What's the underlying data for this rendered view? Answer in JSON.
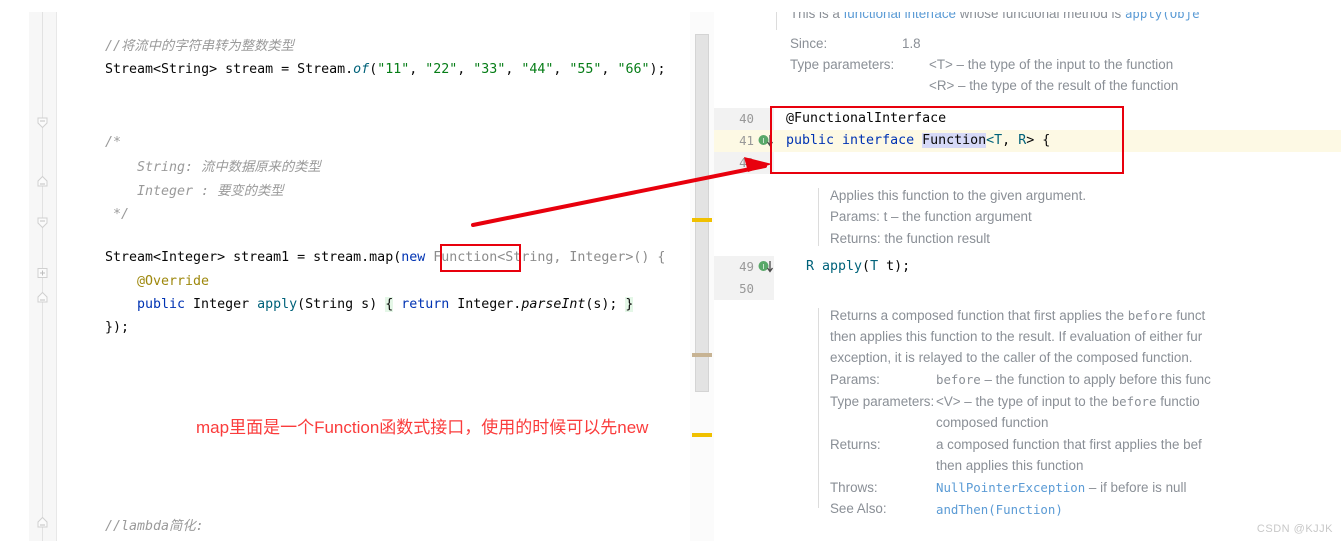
{
  "editor": {
    "lines": [
      {
        "id": "l1",
        "text": "//将流中的字符串转为整数类型"
      },
      {
        "id": "l2",
        "text": "Stream<String> stream = Stream.of(\"11\", \"22\", \"33\", \"44\", \"55\", \"66\");"
      },
      {
        "id": "l3",
        "text": "/*"
      },
      {
        "id": "l4",
        "text": "String: 流中数据原来的类型"
      },
      {
        "id": "l5",
        "text": "Integer : 要变的类型"
      },
      {
        "id": "l6",
        "text": "*/"
      },
      {
        "id": "l7",
        "text": "Stream<Integer> stream1 = stream.map(new Function<String, Integer>() {"
      },
      {
        "id": "l8",
        "text": "@Override"
      },
      {
        "id": "l9",
        "text": "public Integer apply(String s) { return Integer.parseInt(s); }"
      },
      {
        "id": "l10",
        "text": "});"
      },
      {
        "id": "l11",
        "text": "//lambda简化:"
      }
    ],
    "tokens": {
      "comment1": "//将流中的字符串转为整数类型",
      "stream_decl_a": "Stream<String> stream = Stream.",
      "stream_decl_of": "of",
      "stream_decl_b": "(",
      "s11": "\"11\"",
      "s22": "\"22\"",
      "s33": "\"33\"",
      "s44": "\"44\"",
      "s55": "\"55\"",
      "s66": "\"66\"",
      "comma": ", ",
      "stream_decl_end": ");",
      "blk_open": "/*",
      "blk_l1_key": "String:",
      "blk_l1_val": " 流中数据原来的类型",
      "blk_l2_key": "Integer :",
      "blk_l2_val": " 要变的类型",
      "blk_close": "*/",
      "map_a": "Stream<Integer> stream1 = stream.map(",
      "map_new": "new",
      "map_fn": "Function",
      "map_b": "<String, Integer>() {",
      "override": "@Override",
      "apply_kw": "public",
      "apply_a": " Integer ",
      "apply_name": "apply",
      "apply_b": "(String s) ",
      "apply_brace_open": "{",
      "apply_ret": " return ",
      "apply_int": "Integer.",
      "apply_parse": "parseInt",
      "apply_c": "(s); ",
      "apply_brace_close": "}",
      "close": "});",
      "lambda_cmt": "//lambda简化:"
    }
  },
  "doc": {
    "intro_a": "This is a ",
    "intro_link": "functional interface",
    "intro_b": " whose functional method is ",
    "intro_code": "apply(Obje",
    "since_label": "Since:",
    "since_value": "1.8",
    "typeparams_label": "Type parameters:",
    "typeparam_t": "<T> – the type of the input to the function",
    "typeparam_r": "<R> – the type of the result of the function",
    "apply_desc": "Applies this function to the given argument.",
    "apply_params": "Params:  t – the function argument",
    "apply_returns": "Returns: the function result",
    "compose_l1": "Returns a composed function that first applies the ",
    "compose_l1_code": "before",
    "compose_l1_tail": " funct",
    "compose_l2": "then applies this function to the result. If evaluation of either fur",
    "compose_l3": "exception, it is relayed to the caller of the composed function.",
    "params_label": "Params:",
    "params_value_a": "before",
    "params_value_b": " – the function to apply before this func",
    "typeparams2_label": "Type parameters:",
    "typeparams2_v1a": "<V> – the type of input to the ",
    "typeparams2_v1b": "before",
    "typeparams2_v1c": " functio",
    "typeparams2_v2": "composed function",
    "returns_label": "Returns:",
    "returns_v1": "a composed function that first applies the bef",
    "returns_v2": "then applies this function",
    "throws_label": "Throws:",
    "throws_link": "NullPointerException",
    "throws_tail": " – if before is null",
    "seealso_label": "See Also:",
    "seealso_link": "andThen(Function)"
  },
  "source": {
    "line_numbers": [
      "40",
      "41",
      "42",
      "49",
      "50"
    ],
    "code_40_ann": "@FunctionalInterface",
    "code_41_kw": "public interface ",
    "code_41_name": "Function",
    "code_41_tail_a": "<",
    "code_41_t": "T",
    "code_41_sep": ", ",
    "code_41_r": "R",
    "code_41_tail_b": "> {",
    "code_49_r": "R ",
    "code_49_apply": "apply",
    "code_49_a": "(",
    "code_49_t": "T",
    "code_49_b": " t);"
  },
  "annotation": {
    "note": "map里面是一个Function函数式接口，使用的时候可以先new"
  },
  "watermark": {
    "text": "CSDN @KJJK"
  },
  "colors": {
    "annotation_red": "#fa3c3c",
    "box_red": "#e8000d",
    "keyword_blue": "#0033b3",
    "string_green": "#067d17",
    "doc_grey": "#8a8f96",
    "doc_link_blue": "#5b9bd5",
    "highlight_row": "#fdf9e4",
    "warn_yellow": "#f0c000"
  }
}
